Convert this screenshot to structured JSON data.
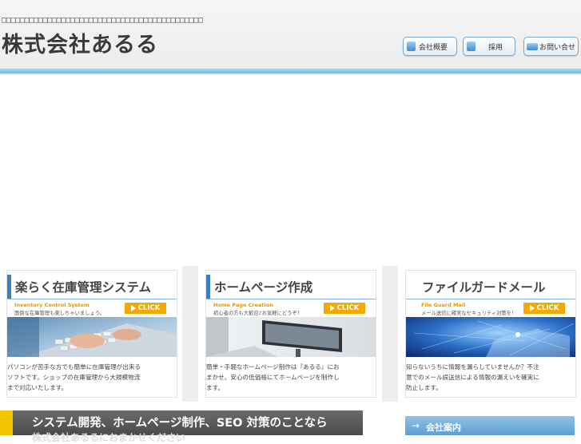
{
  "header": {
    "mojibake_line": "□□□□□□□□□□□□□□□□□□□□□□□□□□□□□□□□□□□□□□□□□□□□",
    "site_title": "株式会社あるる",
    "nav": {
      "about": "会社概要",
      "recruit": "採用",
      "contact": "お問い合せ"
    }
  },
  "services": [
    {
      "title": "楽らく在庫管理システム",
      "en": "Inventory Control System",
      "sub": "面倒な在庫管理も楽しちゃいましょう。",
      "click": "CLICK",
      "desc": "パソコンが苦手な方でも簡単に在庫管理が出来る\nソフトです。ショップの在庫管理から大規模物流\nまで対応いたします。"
    },
    {
      "title": "ホームページ作成",
      "en": "Home Page Creation",
      "sub": "初心者の方も大歓迎♪お気軽にどうぞ！",
      "click": "CLICK",
      "desc": "簡単・手軽なホームページ制作は『あるる』にお\nまかせ。安心の低価格にてホームページを制作し\nます。"
    },
    {
      "title": "ファイルガードメール",
      "en": "File Guard Mail",
      "sub": "メール送信に確実なセキュリティ対策を！",
      "click": "CLICK",
      "desc": "知らないうちに情報を漏らしていませんか？不注\n意でのメール誤送信による情報の漏えいを確実に\n防止します。"
    }
  ],
  "catch": {
    "line1": "システム開発、ホームページ制作、SEO 対策のことなら",
    "line2": "株式会社あるるにおまかせください"
  },
  "company": {
    "arrow": "→",
    "label": "会社案内"
  },
  "colors": {
    "accent_blue": "#3d7fbf",
    "click_orange": "#f2a900",
    "stripe_blue": "#6cbde6",
    "yellow": "#f5c400"
  }
}
